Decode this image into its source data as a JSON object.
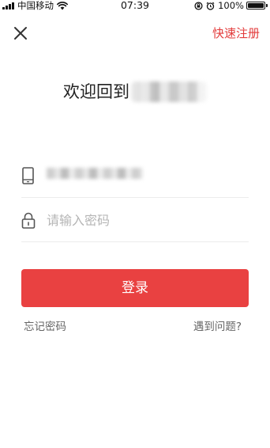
{
  "status_bar": {
    "carrier": "中国移动",
    "time": "07:39",
    "battery": "100%"
  },
  "nav": {
    "close_icon": "close-icon",
    "register_label": "快速注册"
  },
  "title": {
    "welcome": "欢迎回到"
  },
  "phone_field": {
    "icon": "phone-icon"
  },
  "password_field": {
    "icon": "lock-icon",
    "placeholder": "请输入密码"
  },
  "login_button": {
    "label": "登录"
  },
  "links": {
    "forgot": "忘记密码",
    "problem": "遇到问题?"
  },
  "colors": {
    "accent": "#e94141",
    "link_red": "#e33b3b",
    "muted_text": "#666666",
    "placeholder": "#b5b5b5"
  }
}
